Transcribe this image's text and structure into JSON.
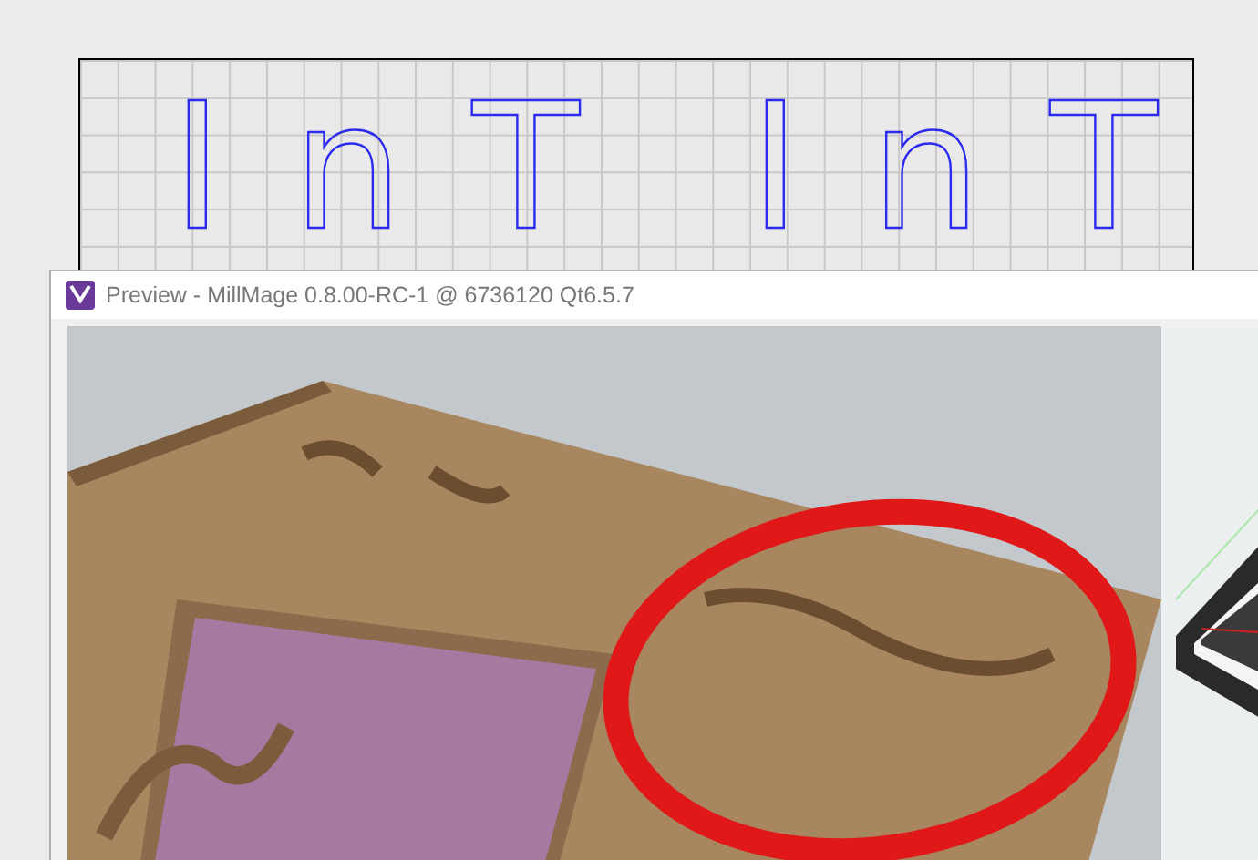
{
  "canvas": {
    "texts": [
      "InT",
      "InT"
    ]
  },
  "preview_window": {
    "title": "Preview - MillMage 0.8.00-RC-1 @ 6736120 Qt6.5.7"
  }
}
